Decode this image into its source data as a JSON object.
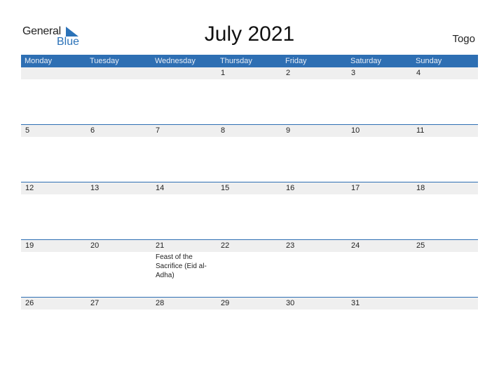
{
  "logo": {
    "word1": "General",
    "word2": "Blue",
    "accent": "#2b72b8"
  },
  "title": "July 2021",
  "country": "Togo",
  "colors": {
    "header_bg": "#2e6fb3",
    "date_strip": "#efefef"
  },
  "weekdays": [
    "Monday",
    "Tuesday",
    "Wednesday",
    "Thursday",
    "Friday",
    "Saturday",
    "Sunday"
  ],
  "weeks": [
    {
      "days": [
        {
          "date": "",
          "event": ""
        },
        {
          "date": "",
          "event": ""
        },
        {
          "date": "",
          "event": ""
        },
        {
          "date": "1",
          "event": ""
        },
        {
          "date": "2",
          "event": ""
        },
        {
          "date": "3",
          "event": ""
        },
        {
          "date": "4",
          "event": ""
        }
      ]
    },
    {
      "days": [
        {
          "date": "5",
          "event": ""
        },
        {
          "date": "6",
          "event": ""
        },
        {
          "date": "7",
          "event": ""
        },
        {
          "date": "8",
          "event": ""
        },
        {
          "date": "9",
          "event": ""
        },
        {
          "date": "10",
          "event": ""
        },
        {
          "date": "11",
          "event": ""
        }
      ]
    },
    {
      "days": [
        {
          "date": "12",
          "event": ""
        },
        {
          "date": "13",
          "event": ""
        },
        {
          "date": "14",
          "event": ""
        },
        {
          "date": "15",
          "event": ""
        },
        {
          "date": "16",
          "event": ""
        },
        {
          "date": "17",
          "event": ""
        },
        {
          "date": "18",
          "event": ""
        }
      ]
    },
    {
      "days": [
        {
          "date": "19",
          "event": ""
        },
        {
          "date": "20",
          "event": ""
        },
        {
          "date": "21",
          "event": "Feast of the Sacrifice (Eid al-Adha)"
        },
        {
          "date": "22",
          "event": ""
        },
        {
          "date": "23",
          "event": ""
        },
        {
          "date": "24",
          "event": ""
        },
        {
          "date": "25",
          "event": ""
        }
      ]
    },
    {
      "days": [
        {
          "date": "26",
          "event": ""
        },
        {
          "date": "27",
          "event": ""
        },
        {
          "date": "28",
          "event": ""
        },
        {
          "date": "29",
          "event": ""
        },
        {
          "date": "30",
          "event": ""
        },
        {
          "date": "31",
          "event": ""
        },
        {
          "date": "",
          "event": ""
        }
      ]
    }
  ]
}
